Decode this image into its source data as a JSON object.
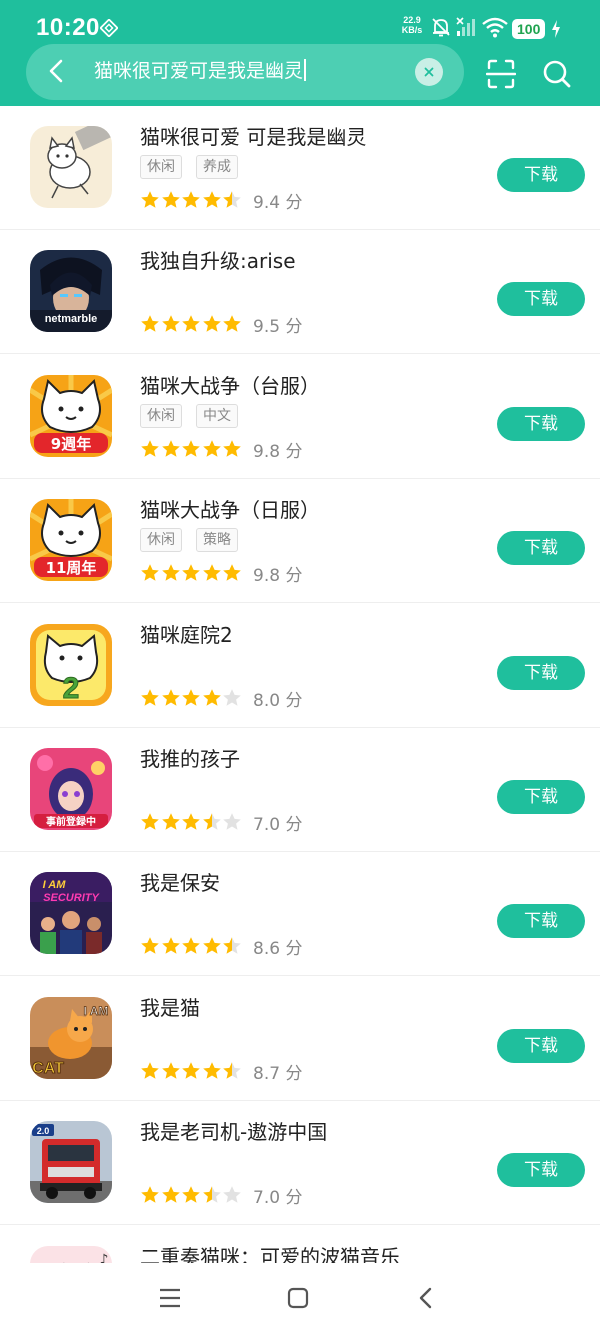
{
  "status": {
    "time": "10:20",
    "net_speed_value": "22.9",
    "net_speed_unit": "KB/s",
    "battery": "100"
  },
  "search": {
    "query": "猫咪很可爱可是我是幽灵"
  },
  "download_label": "下载",
  "score_unit": "分",
  "apps": [
    {
      "title": "猫咪很可爱 可是我是幽灵",
      "tags": [
        "休闲",
        "养成"
      ],
      "rating": 9.4,
      "score": "9.4",
      "icon": "ghost-cat-app-icon"
    },
    {
      "title": "我独自升级:arise",
      "tags": [],
      "rating": 9.5,
      "score": "9.5",
      "icon": "solo-leveling-app-icon",
      "icon_text": "netmarble"
    },
    {
      "title": "猫咪大战争（台服）",
      "tags": [
        "休闲",
        "中文"
      ],
      "rating": 9.8,
      "score": "9.8",
      "icon": "battle-cats-tw-app-icon",
      "icon_text": "9週年"
    },
    {
      "title": "猫咪大战争（日服）",
      "tags": [
        "休闲",
        "策略"
      ],
      "rating": 9.8,
      "score": "9.8",
      "icon": "battle-cats-jp-app-icon",
      "icon_text": "11周年"
    },
    {
      "title": "猫咪庭院2",
      "tags": [],
      "rating": 8.0,
      "score": "8.0",
      "icon": "cat-garden-2-app-icon",
      "icon_text": "2"
    },
    {
      "title": "我推的孩子",
      "tags": [],
      "rating": 7.0,
      "score": "7.0",
      "icon": "oshi-no-ko-app-icon",
      "icon_text": "事前登録中"
    },
    {
      "title": "我是保安",
      "tags": [],
      "rating": 8.6,
      "score": "8.6",
      "icon": "i-am-security-app-icon",
      "icon_text": "I AM SECURITY"
    },
    {
      "title": "我是猫",
      "tags": [],
      "rating": 8.7,
      "score": "8.7",
      "icon": "i-am-cat-app-icon",
      "icon_text": "I AM CAT"
    },
    {
      "title": "我是老司机-遨游中国",
      "tags": [],
      "rating": 7.0,
      "score": "7.0",
      "icon": "truck-driver-app-icon",
      "icon_text": "2.0"
    },
    {
      "title": "二重奏猫咪：可爱的波猫音乐",
      "tags": [],
      "rating": 0,
      "score": "",
      "icon": "duet-cats-app-icon"
    }
  ],
  "colors": {
    "accent": "#1fbf9d",
    "star": "#ffbb00",
    "star_empty": "#e2e2e2"
  }
}
